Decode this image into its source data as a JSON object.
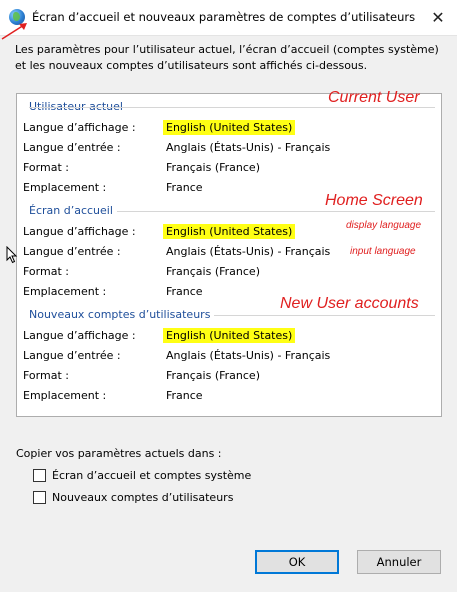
{
  "window": {
    "title": "Écran d’accueil et nouveaux paramètres de comptes d’utilisateurs",
    "close_glyph": "✕"
  },
  "description": "Les paramètres pour l’utilisateur actuel, l’écran d’accueil (comptes système) et les nouveaux comptes d’utilisateurs sont affichés ci-dessous.",
  "labels": {
    "display_lang": "Langue d’affichage :",
    "input_lang": "Langue d’entrée :",
    "format": "Format :",
    "location": "Emplacement :"
  },
  "sections": [
    {
      "title": "Utilisateur actuel",
      "display_lang": "English (United States)",
      "input_lang": "Anglais (États-Unis) - Français",
      "format": "Français (France)",
      "location": "France"
    },
    {
      "title": "Écran d’accueil",
      "display_lang": "English (United States)",
      "input_lang": "Anglais (États-Unis) - Français",
      "format": "Français (France)",
      "location": "France"
    },
    {
      "title": "Nouveaux comptes d’utilisateurs",
      "display_lang": "English (United States)",
      "input_lang": "Anglais (États-Unis) - Français",
      "format": "Français (France)",
      "location": "France"
    }
  ],
  "annotations": {
    "current_user": "Current User",
    "home_screen": "Home Screen",
    "display_language": "display language",
    "input_language": "input language",
    "new_user_accounts": "New User accounts"
  },
  "copy": {
    "label": "Copier vos paramètres actuels dans :",
    "options": [
      {
        "label": "Écran d’accueil et comptes système",
        "checked": false
      },
      {
        "label": "Nouveaux comptes d’utilisateurs",
        "checked": false
      }
    ]
  },
  "buttons": {
    "ok": "OK",
    "cancel": "Annuler"
  },
  "colors": {
    "highlight": "#ffff14",
    "annotation": "#e02020",
    "section_title": "#1e4e9a",
    "default_button_border": "#0078d7"
  }
}
